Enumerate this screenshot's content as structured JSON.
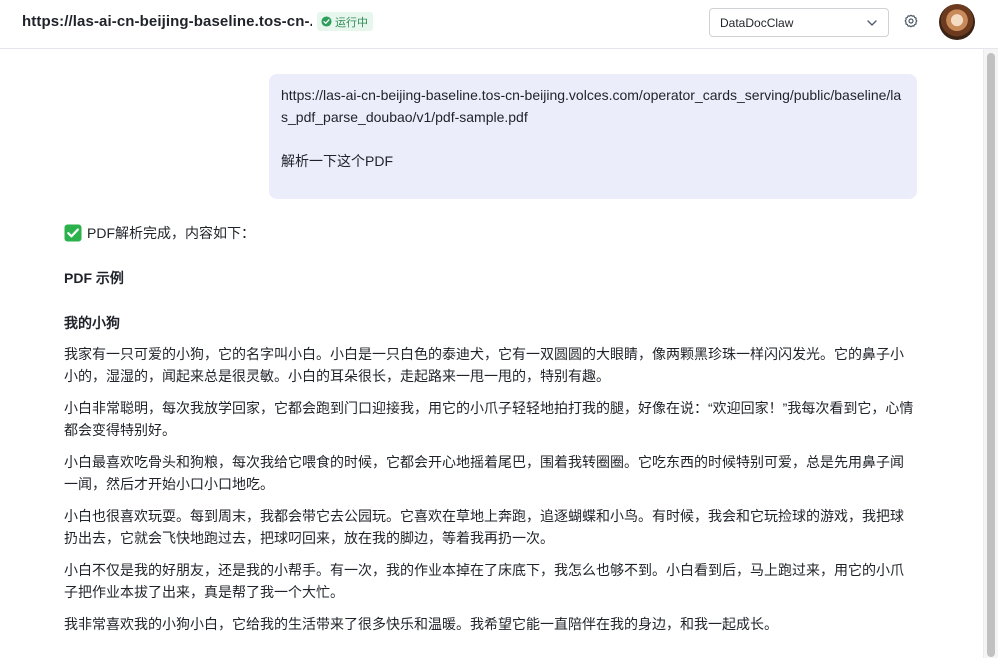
{
  "header": {
    "url": "https://las-ai-cn-beijing-baseline.tos-cn-...",
    "status": "运行中",
    "model_select": {
      "selected": "DataDocClaw"
    },
    "icons": {
      "status": "check-circle-icon",
      "dropdown": "chevron-down-icon",
      "settings": "gear-icon"
    }
  },
  "colors": {
    "status_green": "#2e8b57",
    "status_bg": "#e8f7ee",
    "bubble_bg": "#ebedfa",
    "check_green": "#2bb24c"
  },
  "chat": {
    "user_message": {
      "link": "https://las-ai-cn-beijing-baseline.tos-cn-beijing.volces.com/operator_cards_serving/public/baseline/las_pdf_parse_doubao/v1/pdf-sample.pdf",
      "text": "解析一下这个PDF"
    },
    "assistant_message": {
      "intro": "PDF解析完成，内容如下：",
      "title": "PDF 示例",
      "subtitle": "我的小狗",
      "paragraphs": [
        "我家有一只可爱的小狗，它的名字叫小白。小白是一只白色的泰迪犬，它有一双圆圆的大眼睛，像两颗黑珍珠一样闪闪发光。它的鼻子小小的，湿湿的，闻起来总是很灵敏。小白的耳朵很长，走起路来一甩一甩的，特别有趣。",
        "小白非常聪明，每次我放学回家，它都会跑到门口迎接我，用它的小爪子轻轻地拍打我的腿，好像在说：“欢迎回家！”我每次看到它，心情都会变得特别好。",
        "小白最喜欢吃骨头和狗粮，每次我给它喂食的时候，它都会开心地摇着尾巴，围着我转圈圈。它吃东西的时候特别可爱，总是先用鼻子闻一闻，然后才开始小口小口地吃。",
        "小白也很喜欢玩耍。每到周末，我都会带它去公园玩。它喜欢在草地上奔跑，追逐蝴蝶和小鸟。有时候，我会和它玩捡球的游戏，我把球扔出去，它就会飞快地跑过去，把球叼回来，放在我的脚边，等着我再扔一次。",
        "小白不仅是我的好朋友，还是我的小帮手。有一次，我的作业本掉在了床底下，我怎么也够不到。小白看到后，马上跑过来，用它的小爪子把作业本拔了出来，真是帮了我一个大忙。",
        "我非常喜欢我的小狗小白，它给我的生活带来了很多快乐和温暖。我希望它能一直陪伴在我的身边，和我一起成长。"
      ]
    }
  }
}
